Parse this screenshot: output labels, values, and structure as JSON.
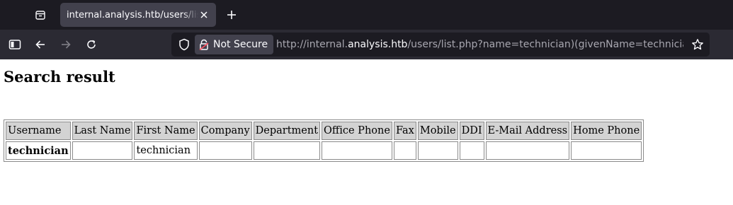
{
  "browser": {
    "tab": {
      "title": "internal.analysis.htb/users/list"
    },
    "address": {
      "security_label": "Not Secure",
      "url_prefix": "http://internal.",
      "url_host": "analysis.htb",
      "url_suffix": "/users/list.php?name=technician)(givenName=technician"
    },
    "icons": [
      "tab-overview-icon",
      "close-icon",
      "plus-icon",
      "sidebar-icon",
      "back-arrow-icon",
      "forward-arrow-icon",
      "reload-icon",
      "shield-icon",
      "broken-lock-icon",
      "star-icon"
    ],
    "colors": {
      "tabstrip": "#1c1b22",
      "navbar": "#2b2a33",
      "active_tab": "#42414d",
      "urlbar": "#1c1b22"
    }
  },
  "page": {
    "title": "Search result",
    "table": {
      "headers": [
        "Username",
        "Last Name",
        "First Name",
        "Company",
        "Department",
        "Office Phone",
        "Fax",
        "Mobile",
        "DDI",
        "E-Mail Address",
        "Home Phone"
      ],
      "rows": [
        [
          "technician",
          "",
          "technician",
          "",
          "",
          "",
          "",
          "",
          "",
          "",
          ""
        ]
      ]
    },
    "colors": {
      "header_bg": "#d3d3d3",
      "cell_border": "#8a8a8a"
    }
  }
}
